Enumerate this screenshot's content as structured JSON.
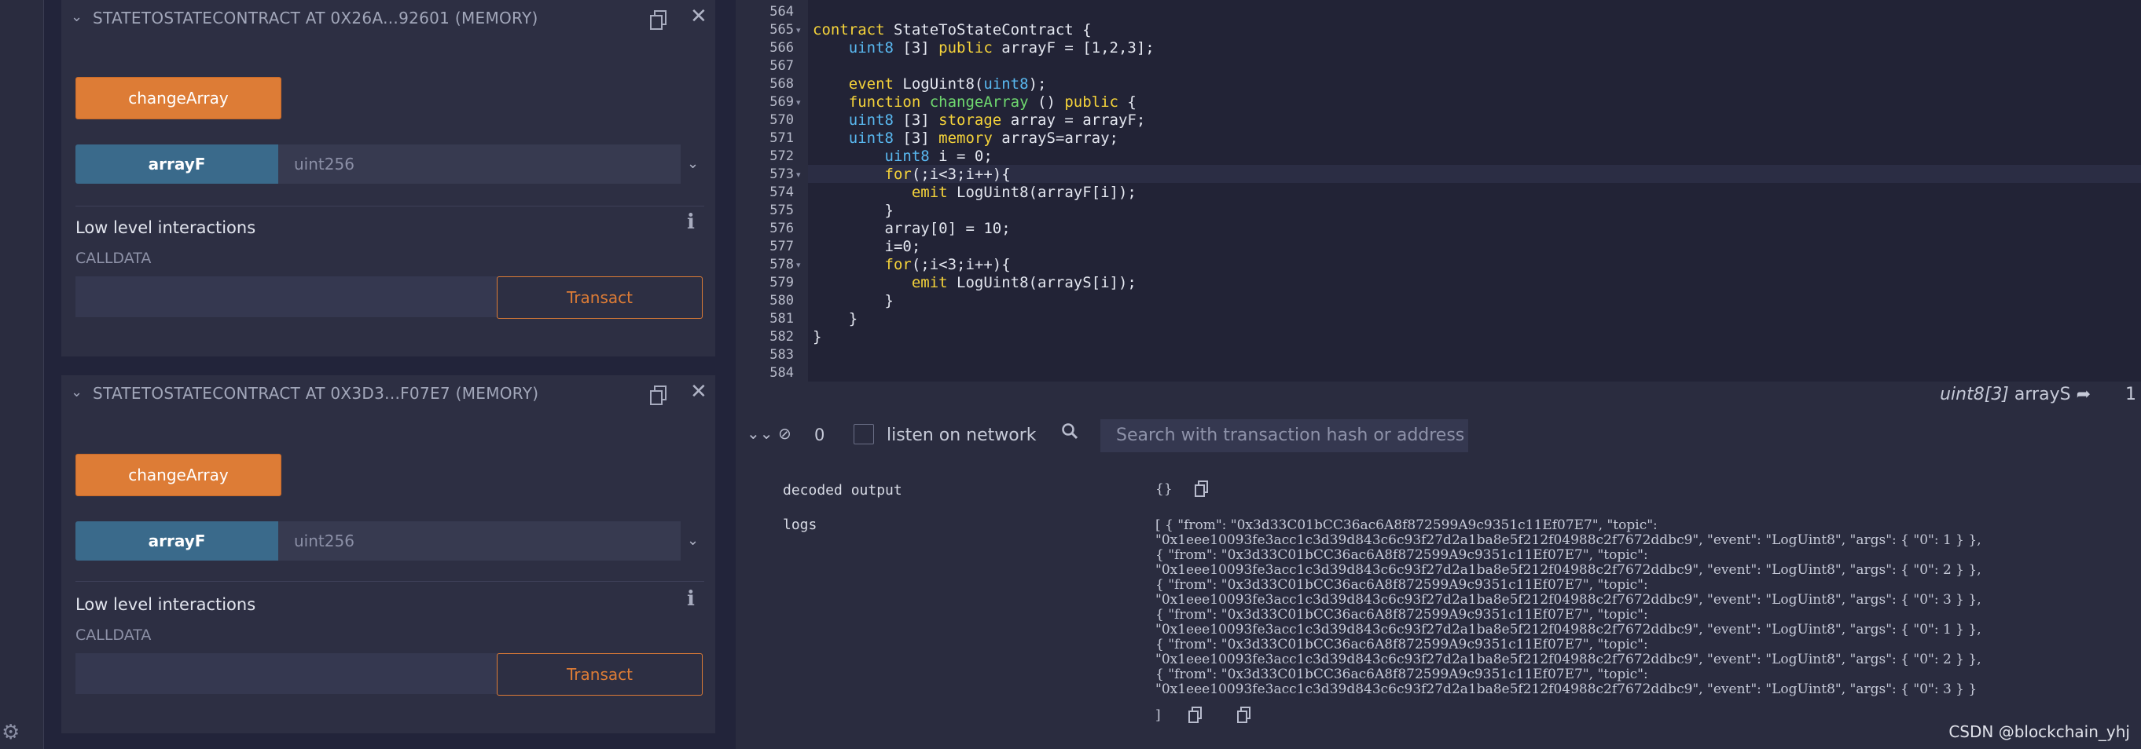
{
  "contracts": [
    {
      "title": "STATETOSTATECONTRACT AT 0X26A...92601 (MEMORY)",
      "function_button": "changeArray",
      "call_button": "arrayF",
      "call_input_placeholder": "uint256",
      "low_level_title": "Low level interactions",
      "calldata_label": "CALLDATA",
      "transact_label": "Transact"
    },
    {
      "title": "STATETOSTATECONTRACT AT 0X3D3...F07E7 (MEMORY)",
      "function_button": "changeArray",
      "call_button": "arrayF",
      "call_input_placeholder": "uint256",
      "low_level_title": "Low level interactions",
      "calldata_label": "CALLDATA",
      "transact_label": "Transact"
    }
  ],
  "editor": {
    "line_numbers": [
      "564",
      "565",
      "566",
      "567",
      "568",
      "569",
      "570",
      "571",
      "572",
      "573",
      "574",
      "575",
      "576",
      "577",
      "578",
      "579",
      "580",
      "581",
      "582",
      "583",
      "584"
    ],
    "lines": [
      "",
      "contract StateToStateContract {",
      "    uint8 [3] public arrayF = [1,2,3];",
      "",
      "    event LogUint8(uint8);",
      "    function changeArray () public {",
      "    uint8 [3] storage array = arrayF;",
      "    uint8 [3] memory arrayS=array;",
      "        uint8 i = 0;",
      "        for(;i<3;i++){",
      "           emit LogUint8(arrayF[i]);",
      "        }",
      "        array[0] = 10;",
      "        i=0;",
      "        for(;i<3;i++){",
      "           emit LogUint8(arrayS[i]);",
      "        }",
      "    }",
      "}",
      "",
      ""
    ],
    "status_type": "uint8[3]",
    "status_name": "arrayS",
    "status_count": "1"
  },
  "terminal": {
    "pending_count": "0",
    "listen_label": "listen on network",
    "search_placeholder": "Search with transaction hash or address",
    "decoded_output_label": "decoded output",
    "decoded_output_value": "{}",
    "logs_label": "logs",
    "logs_lines": [
      "[ { \"from\": \"0x3d33C01bCC36ac6A8f872599A9c9351c11Ef07E7\", \"topic\":",
      "\"0x1eee10093fe3acc1c3d39d843c6c93f27d2a1ba8e5f212f04988c2f7672ddbc9\", \"event\": \"LogUint8\", \"args\": { \"0\": 1 } },",
      "{ \"from\": \"0x3d33C01bCC36ac6A8f872599A9c9351c11Ef07E7\", \"topic\":",
      "\"0x1eee10093fe3acc1c3d39d843c6c93f27d2a1ba8e5f212f04988c2f7672ddbc9\", \"event\": \"LogUint8\", \"args\": { \"0\": 2 } },",
      "{ \"from\": \"0x3d33C01bCC36ac6A8f872599A9c9351c11Ef07E7\", \"topic\":",
      "\"0x1eee10093fe3acc1c3d39d843c6c93f27d2a1ba8e5f212f04988c2f7672ddbc9\", \"event\": \"LogUint8\", \"args\": { \"0\": 3 } },",
      "{ \"from\": \"0x3d33C01bCC36ac6A8f872599A9c9351c11Ef07E7\", \"topic\":",
      "\"0x1eee10093fe3acc1c3d39d843c6c93f27d2a1ba8e5f212f04988c2f7672ddbc9\", \"event\": \"LogUint8\", \"args\": { \"0\": 1 } },",
      "{ \"from\": \"0x3d33C01bCC36ac6A8f872599A9c9351c11Ef07E7\", \"topic\":",
      "\"0x1eee10093fe3acc1c3d39d843c6c93f27d2a1ba8e5f212f04988c2f7672ddbc9\", \"event\": \"LogUint8\", \"args\": { \"0\": 2 } },",
      "{ \"from\": \"0x3d33C01bCC36ac6A8f872599A9c9351c11Ef07E7\", \"topic\":",
      "\"0x1eee10093fe3acc1c3d39d843c6c93f27d2a1ba8e5f212f04988c2f7672ddbc9\", \"event\": \"LogUint8\", \"args\": { \"0\": 3 } }"
    ],
    "logs_close": "]"
  },
  "watermark": "CSDN @blockchain_yhj",
  "colors": {
    "accent_orange": "#dd7c36",
    "call_blue": "#3a6a8b",
    "panel_bg": "#2d2f43",
    "editor_bg": "#222336",
    "keyword_yellow": "#f5d33a",
    "type_blue": "#59b8f0"
  },
  "icons": {
    "settings": "gear-icon",
    "copy": "copy-icon",
    "close": "close-icon",
    "collapse": "chevron-down-icon",
    "info": "info-icon",
    "clear": "clear-icon",
    "search": "search-icon",
    "goto": "goto-definition-icon"
  }
}
